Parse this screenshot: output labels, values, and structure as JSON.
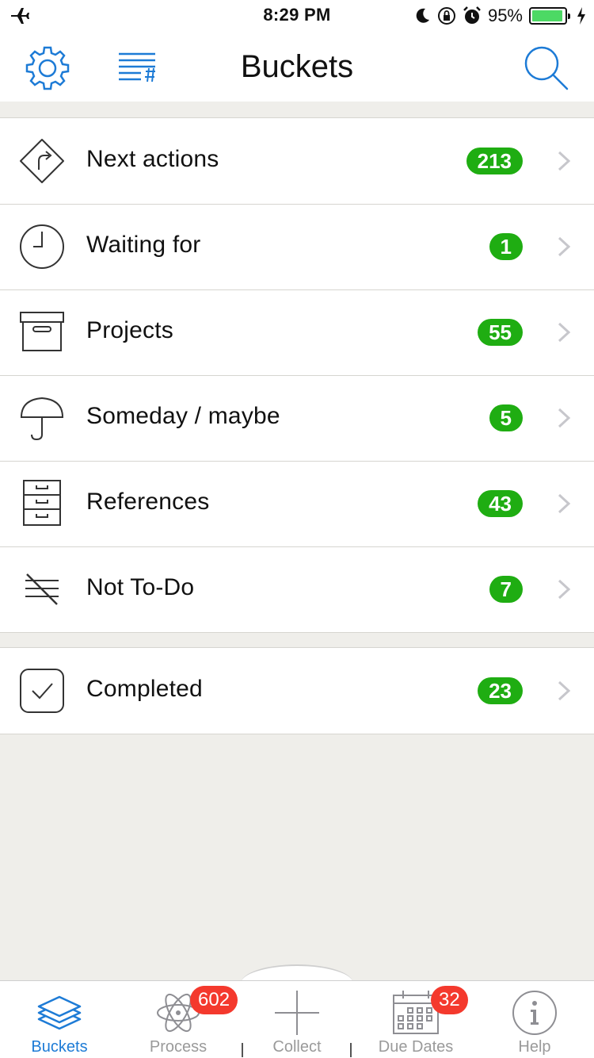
{
  "status_bar": {
    "time": "8:29 PM",
    "battery_percent": "95%",
    "battery_level": 0.95,
    "icons": [
      "airplane-icon",
      "moon-icon",
      "rotation-lock-icon",
      "alarm-icon",
      "battery-icon",
      "charging-icon"
    ]
  },
  "nav": {
    "title": "Buckets",
    "left_icons": [
      "gear-icon",
      "tags-list-icon"
    ],
    "right_icons": [
      "search-icon"
    ]
  },
  "colors": {
    "accent": "#1d7bd6",
    "badge_green": "#1fad12",
    "badge_red": "#f4392d",
    "background": "#efeeea"
  },
  "buckets": [
    {
      "label": "Next actions",
      "count": "213",
      "icon": "road-sign-icon"
    },
    {
      "label": "Waiting for",
      "count": "1",
      "icon": "clock-icon"
    },
    {
      "label": "Projects",
      "count": "55",
      "icon": "archive-box-icon"
    },
    {
      "label": "Someday / maybe",
      "count": "5",
      "icon": "umbrella-icon"
    },
    {
      "label": "References",
      "count": "43",
      "icon": "file-cabinet-icon"
    },
    {
      "label": "Not To-Do",
      "count": "7",
      "icon": "strike-lines-icon"
    }
  ],
  "completed": {
    "label": "Completed",
    "count": "23",
    "icon": "checkbox-icon"
  },
  "tabs": [
    {
      "label": "Buckets",
      "icon": "layers-icon",
      "active": true
    },
    {
      "label": "Process",
      "icon": "atom-icon",
      "badge": "602"
    },
    {
      "label": "Collect",
      "icon": "plus-icon"
    },
    {
      "label": "Due Dates",
      "icon": "calendar-icon",
      "badge": "32"
    },
    {
      "label": "Help",
      "icon": "info-icon"
    }
  ]
}
